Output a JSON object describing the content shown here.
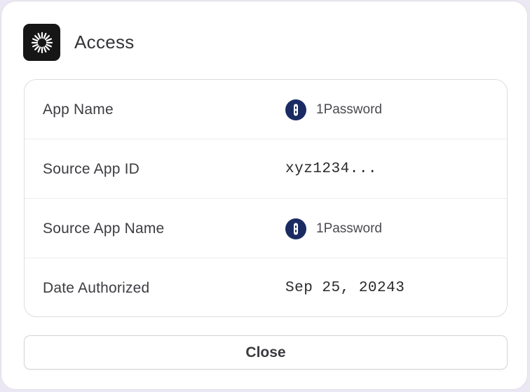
{
  "dialog": {
    "title": "Access",
    "logo_icon": "sunburst-logo-icon"
  },
  "details": [
    {
      "label": "App Name",
      "value": "1Password",
      "icon": "1password-icon",
      "monospace": false
    },
    {
      "label": "Source App ID",
      "value": "xyz1234...",
      "icon": null,
      "monospace": true
    },
    {
      "label": "Source App Name",
      "value": "1Password",
      "icon": "1password-icon",
      "monospace": false
    },
    {
      "label": "Date Authorized",
      "value": "Sep 25, 20243",
      "icon": null,
      "monospace": true
    }
  ],
  "actions": {
    "close_label": "Close"
  },
  "colors": {
    "logo_bg": "#161616",
    "onepassword_blue": "#1a2b63"
  }
}
